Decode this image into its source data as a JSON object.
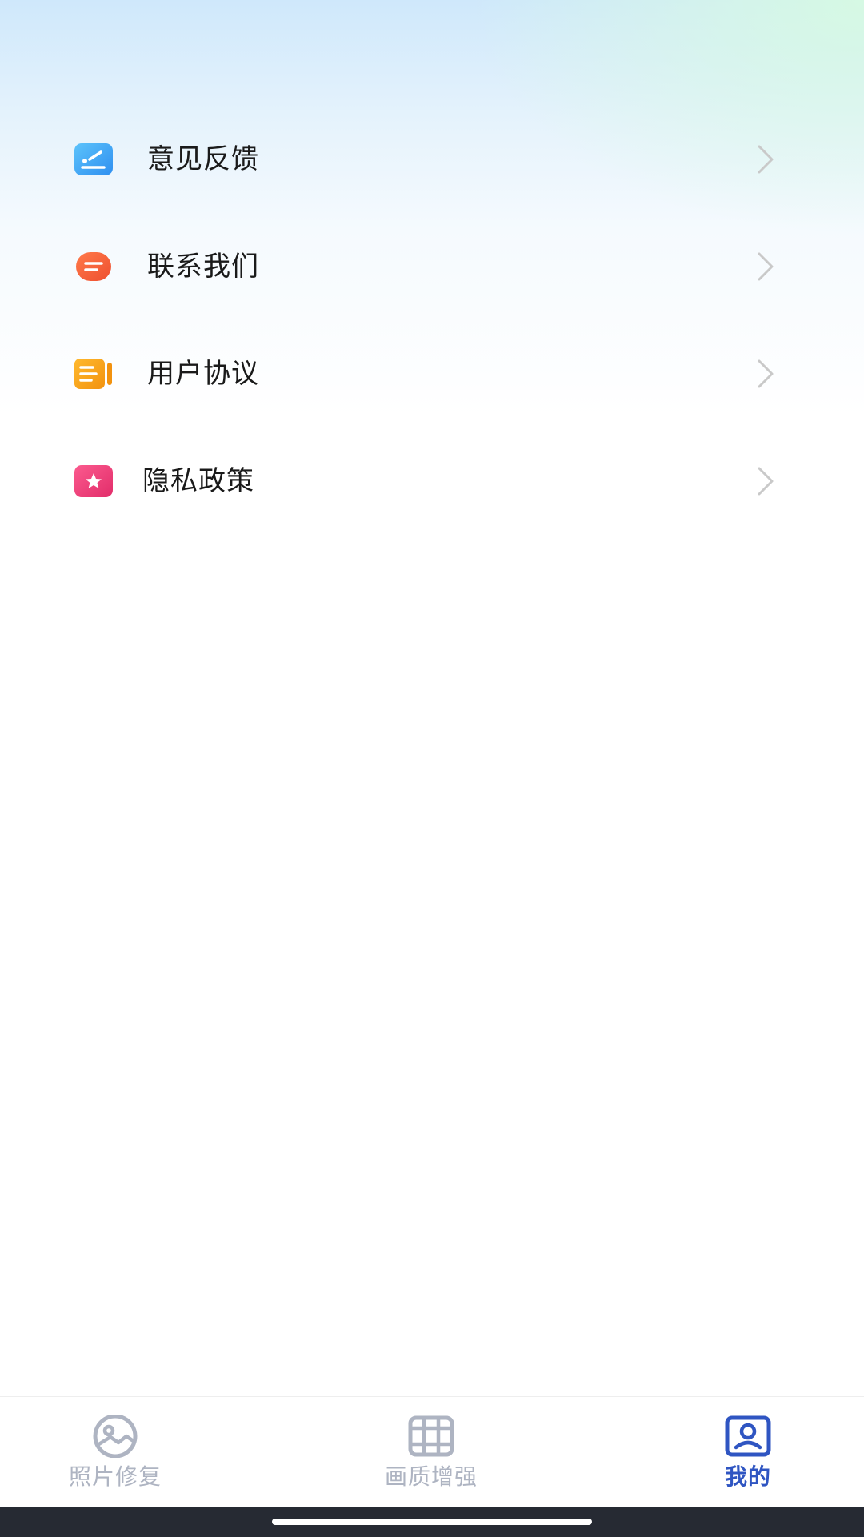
{
  "menu": {
    "items": [
      {
        "label": "意见反馈",
        "icon": "feedback-icon",
        "color": "#3fa9f5"
      },
      {
        "label": "联系我们",
        "icon": "contact-icon",
        "color": "#f2643c"
      },
      {
        "label": "用户协议",
        "icon": "agreement-icon",
        "color": "#f5a318"
      },
      {
        "label": "隐私政策",
        "icon": "privacy-icon",
        "color": "#ee3f7a"
      }
    ]
  },
  "tabbar": {
    "tabs": [
      {
        "label": "照片修复",
        "icon": "photo-icon",
        "active": false
      },
      {
        "label": "画质增强",
        "icon": "film-icon",
        "active": false
      },
      {
        "label": "我的",
        "icon": "profile-icon",
        "active": true
      }
    ],
    "active_color": "#2f55c2",
    "inactive_color": "#aeb4c2"
  }
}
